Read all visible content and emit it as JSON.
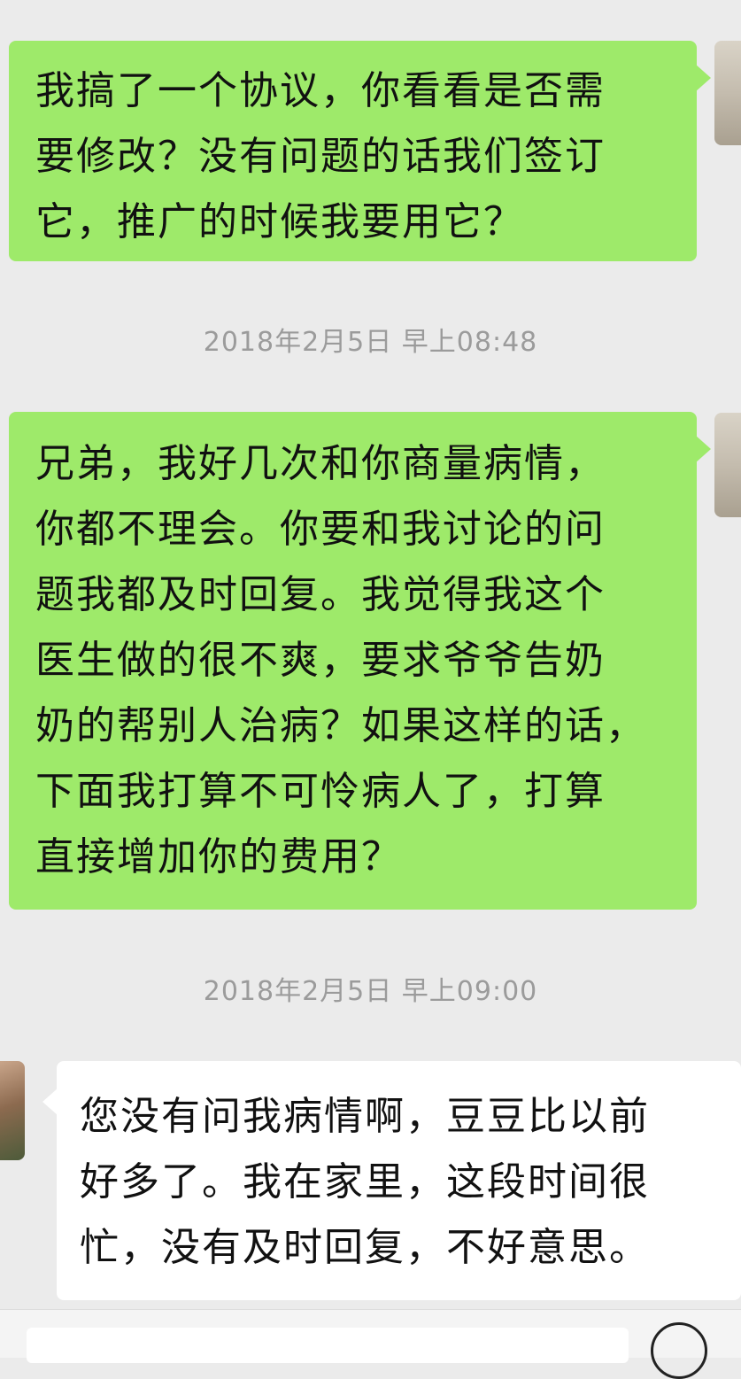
{
  "messages": [
    {
      "direction": "outgoing",
      "text": "我搞了一个协议，你看看是否需\n要修改？没有问题的话我们签订\n它，推广的时候我要用它？"
    },
    {
      "type": "timestamp",
      "text": "2018年2月5日 早上08:48"
    },
    {
      "direction": "outgoing",
      "text": "兄弟，我好几次和你商量病情，\n你都不理会。你要和我讨论的问\n题我都及时回复。我觉得我这个\n医生做的很不爽，要求爷爷告奶\n奶的帮别人治病？如果这样的话，\n下面我打算不可怜病人了，打算\n直接增加你的费用？"
    },
    {
      "type": "timestamp",
      "text": "2018年2月5日 早上09:00"
    },
    {
      "direction": "incoming",
      "text": "您没有问我病情啊，豆豆比以前\n好多了。我在家里，这段时间很\n忙，没有及时回复，不好意思。"
    }
  ],
  "colors": {
    "background": "#ebebeb",
    "outgoing_bubble": "#9eea6a",
    "incoming_bubble": "#ffffff",
    "timestamp_text": "#9b9b9b"
  },
  "icons": {
    "self_avatar": "avatar",
    "contact_avatar": "avatar",
    "input_mode": "voice-icon"
  }
}
